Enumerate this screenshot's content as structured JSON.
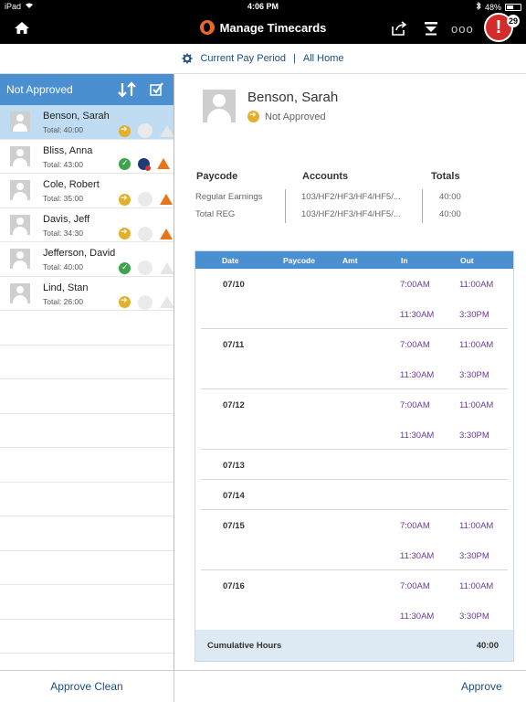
{
  "status_bar": {
    "device": "iPad",
    "time": "4:06 PM",
    "battery": "48%"
  },
  "nav": {
    "title": "Manage Timecards",
    "more": "ooo",
    "alert_symbol": "!",
    "alert_count": "29"
  },
  "filter": {
    "period": "Current Pay Period",
    "separator": "|",
    "group": "All Home"
  },
  "list": {
    "header": "Not Approved",
    "employees": [
      {
        "name": "Benson, Sarah",
        "total": "Total: 40:00",
        "icons": [
          "arrow-icon",
          "empty-circle-icon",
          "empty-triangle-icon"
        ]
      },
      {
        "name": "Bliss, Anna",
        "total": "Total: 43:00",
        "icons": [
          "check-icon",
          "person-alert-icon",
          "warning-icon"
        ]
      },
      {
        "name": "Cole, Robert",
        "total": "Total: 35:00",
        "icons": [
          "arrow-icon",
          "empty-circle-icon",
          "warning-icon"
        ]
      },
      {
        "name": "Davis, Jeff",
        "total": "Total: 34:30",
        "icons": [
          "arrow-icon",
          "empty-circle-icon",
          "warning-icon"
        ]
      },
      {
        "name": "Jefferson, David",
        "total": "Total: 40:00",
        "icons": [
          "check-icon",
          "empty-circle-icon",
          "empty-triangle-icon"
        ]
      },
      {
        "name": "Lind, Stan",
        "total": "Total: 26:00",
        "icons": [
          "arrow-icon",
          "empty-circle-icon",
          "empty-triangle-icon"
        ]
      }
    ]
  },
  "detail": {
    "name": "Benson, Sarah",
    "status": "Not Approved",
    "summary": {
      "headers": {
        "paycode": "Paycode",
        "accounts": "Accounts",
        "totals": "Totals"
      },
      "rows": [
        {
          "paycode": "Regular Earnings",
          "account": "103/HF2/HF3/HF4/HF5/...",
          "total": "40:00"
        },
        {
          "paycode": "Total REG",
          "account": "103/HF2/HF3/HF4/HF5/...",
          "total": "40:00"
        }
      ]
    },
    "table": {
      "headers": {
        "date": "Date",
        "paycode": "Paycode",
        "amt": "Amt",
        "in": "In",
        "out": "Out"
      },
      "days": [
        {
          "date": "07/10",
          "punches": [
            {
              "in": "7:00AM",
              "out": "11:00AM"
            },
            {
              "in": "11:30AM",
              "out": "3:30PM"
            }
          ]
        },
        {
          "date": "07/11",
          "punches": [
            {
              "in": "7:00AM",
              "out": "11:00AM"
            },
            {
              "in": "11:30AM",
              "out": "3:30PM"
            }
          ]
        },
        {
          "date": "07/12",
          "punches": [
            {
              "in": "7:00AM",
              "out": "11:00AM"
            },
            {
              "in": "11:30AM",
              "out": "3:30PM"
            }
          ]
        },
        {
          "date": "07/13",
          "punches": []
        },
        {
          "date": "07/14",
          "punches": []
        },
        {
          "date": "07/15",
          "punches": [
            {
              "in": "7:00AM",
              "out": "11:00AM"
            },
            {
              "in": "11:30AM",
              "out": "3:30PM"
            }
          ]
        },
        {
          "date": "07/16",
          "punches": [
            {
              "in": "7:00AM",
              "out": "11:00AM"
            },
            {
              "in": "11:30AM",
              "out": "3:30PM"
            }
          ]
        }
      ],
      "cumulative_label": "Cumulative Hours",
      "cumulative_value": "40:00"
    }
  },
  "footer": {
    "approve_clean": "Approve Clean",
    "approve": "Approve"
  },
  "colors": {
    "accent": "#4a90d0",
    "selected_row": "#bfdcf2",
    "punch_text": "#6b3a96",
    "alert": "#d42b2b"
  }
}
